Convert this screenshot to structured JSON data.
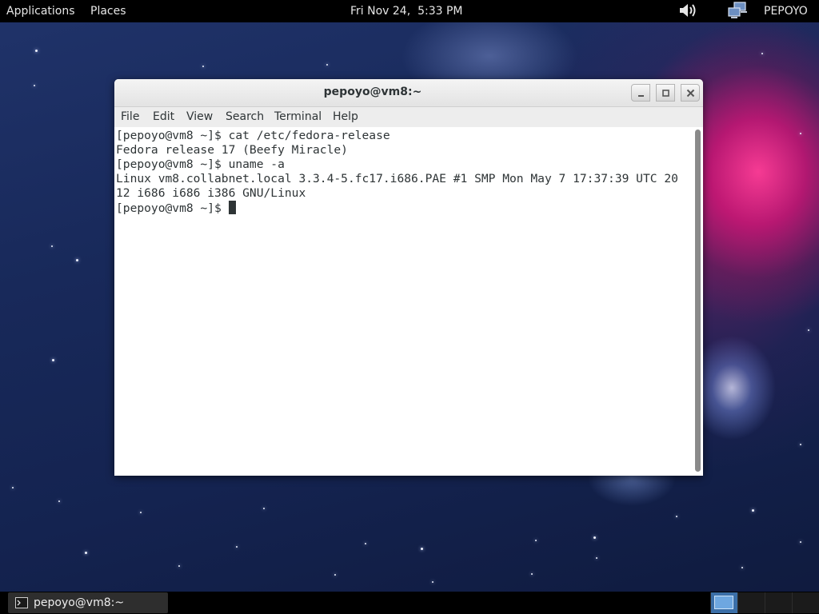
{
  "top_panel": {
    "applications": "Applications",
    "places": "Places",
    "clock": "Fri Nov 24,  5:33 PM",
    "user": "PEPOYO",
    "volume_icon": "speaker-volume-icon",
    "network_icon": "network-computer-icon"
  },
  "window": {
    "title": "pepoyo@vm8:~",
    "menu": [
      "File",
      "Edit",
      "View",
      "Search",
      "Terminal",
      "Help"
    ],
    "controls": [
      "minimize-icon",
      "maximize-icon",
      "close-icon"
    ]
  },
  "terminal": {
    "lines": [
      "[pepoyo@vm8 ~]$ cat /etc/fedora-release",
      "Fedora release 17 (Beefy Miracle)",
      "[pepoyo@vm8 ~]$ uname -a",
      "Linux vm8.collabnet.local 3.3.4-5.fc17.i686.PAE #1 SMP Mon May 7 17:37:39 UTC 20",
      "12 i686 i686 i386 GNU/Linux",
      "[pepoyo@vm8 ~]$ "
    ]
  },
  "bottom_panel": {
    "task_label": "pepoyo@vm8:~",
    "task_icon": "terminal-icon",
    "workspaces": 4,
    "active_workspace": 1
  },
  "colors": {
    "panel": "#000000",
    "terminal_text": "#2e3436",
    "terminal_bg": "#ffffff",
    "active_workspace": "#3b6fa8"
  }
}
